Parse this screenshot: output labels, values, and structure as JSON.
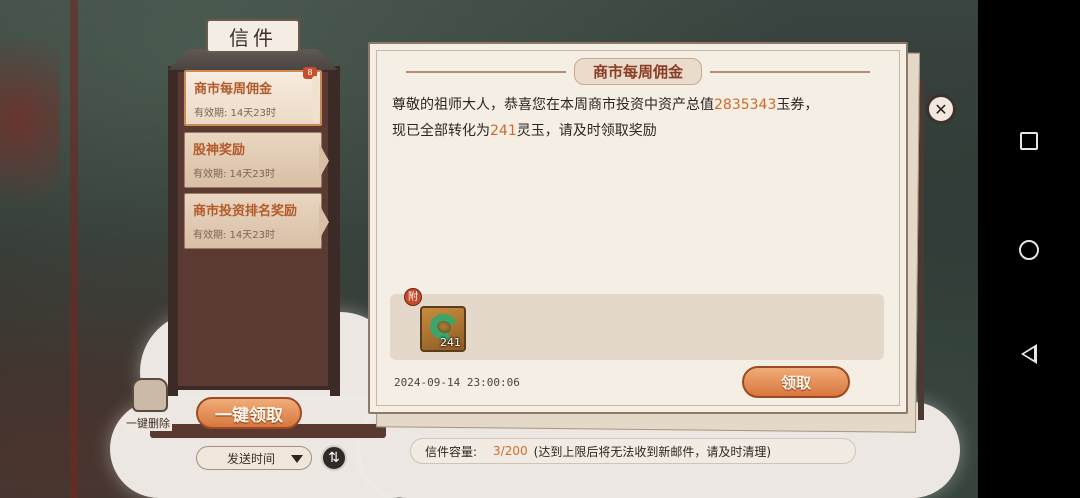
{
  "mailbox": {
    "title": "信件",
    "items": [
      {
        "title": "商市每周佣金",
        "expiry": "有效期: 14天23时"
      },
      {
        "title": "股神奖励",
        "expiry": "有效期: 14天23时"
      },
      {
        "title": "商市投资排名奖励",
        "expiry": "有效期: 14天23时"
      }
    ],
    "claim_all_label": "一键领取",
    "delete_all_label": "一键删除",
    "sort_label": "发送时间",
    "seal_text": "8"
  },
  "letter": {
    "title": "商市每周佣金",
    "line1_a": "尊敬的祖师大人，恭喜您在本周商市投资中资产总值",
    "line1_value": "2835343",
    "line1_b": "玉券，",
    "line2_a": "现已全部转化为",
    "line2_value": "241",
    "line2_b": "灵玉，请及时领取奖励",
    "attach_tag": "附",
    "attachment": {
      "icon": "jade-icon",
      "count": "241"
    },
    "timestamp": "2024-09-14 23:00:06",
    "claim_label": "领取"
  },
  "capacity": {
    "label": "信件容量:",
    "value": "3/200",
    "note": "(达到上限后将无法收到新邮件，请及时清理)"
  },
  "colors": {
    "accent": "#d26a2a",
    "button": "#e08a4f"
  }
}
